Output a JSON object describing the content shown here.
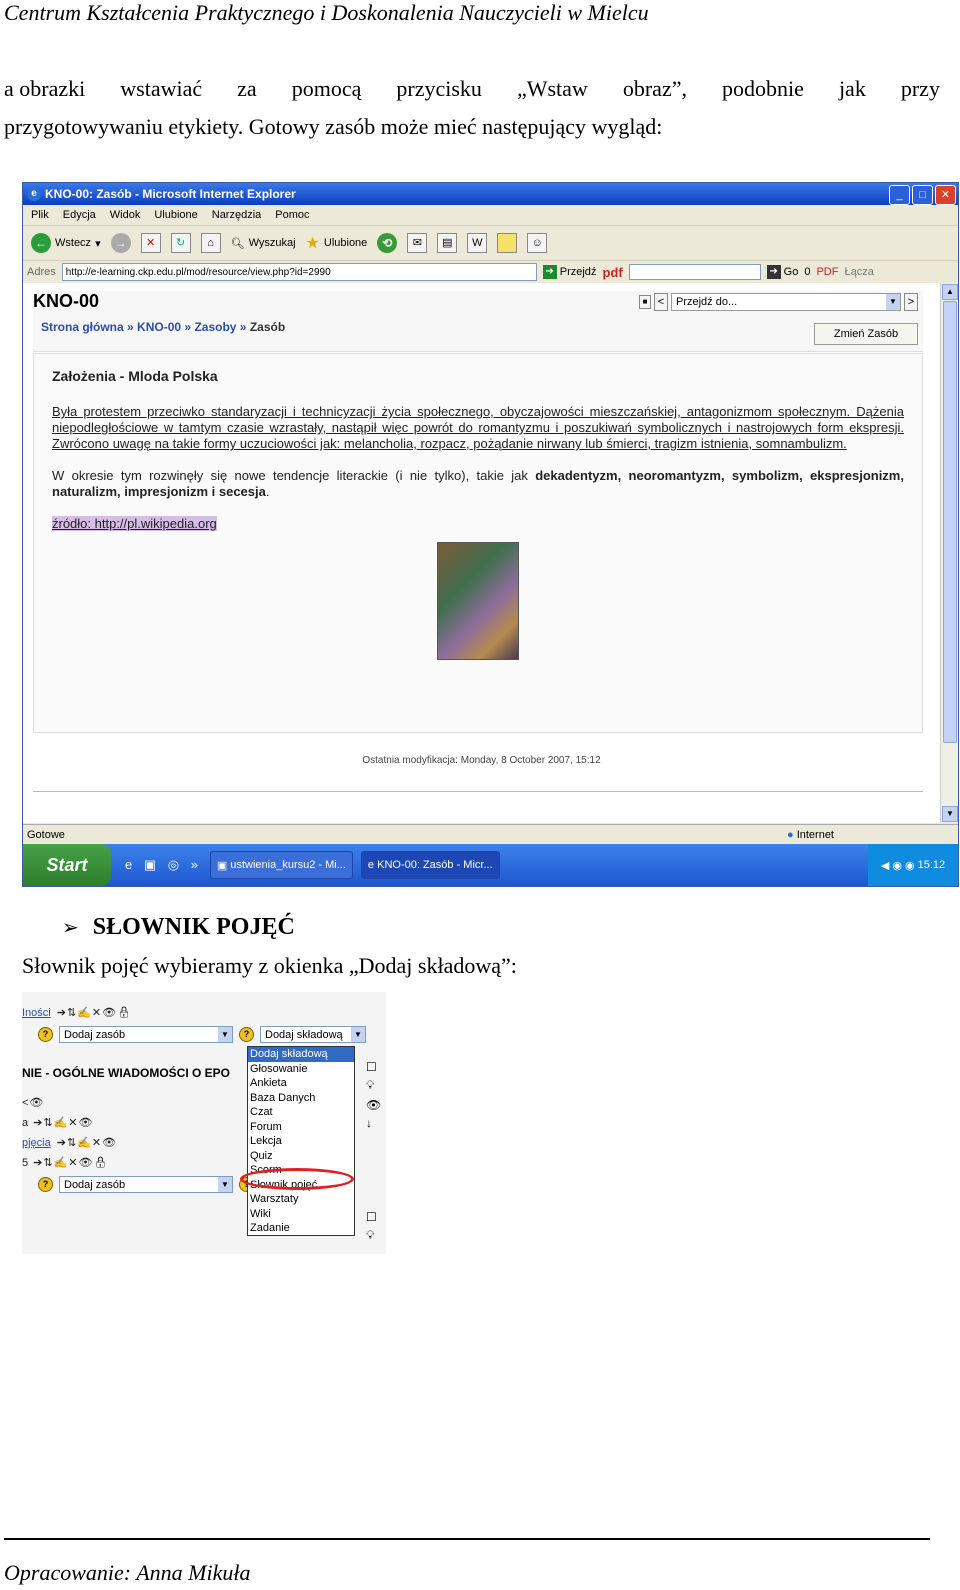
{
  "header": {
    "text": "Centrum Kształcenia Praktycznego i Doskonalenia Nauczycieli w Mielcu"
  },
  "paragraph1": {
    "line1_words": [
      "a obrazki",
      "wstawiać",
      "za",
      "pomocą",
      "przycisku",
      "„Wstaw",
      "obraz”,",
      "podobnie",
      "jak",
      "przy"
    ],
    "line2": "przygotowywaniu etykiety. Gotowy zasób może mieć następujący wygląd:"
  },
  "ie_window": {
    "title": "KNO-00: Zasób - Microsoft Internet Explorer",
    "menu": [
      "Plik",
      "Edycja",
      "Widok",
      "Ulubione",
      "Narzędzia",
      "Pomoc"
    ],
    "toolbar": {
      "back": "Wstecz",
      "search": "Wyszukaj",
      "favorites": "Ulubione"
    },
    "address_label": "Adres",
    "address_url": "http://e-learning.ckp.edu.pl/mod/resource/view.php?id=2990",
    "go_label": "Przejdź",
    "pdf_label": "pdf",
    "go2_label": "Go",
    "counter": "0",
    "pdf2_label": "PDF",
    "links_label": "Łącza",
    "status_left": "Gotowe",
    "status_right": "Internet",
    "taskbar": {
      "start": "Start",
      "task1": "ustwienia_kursu2 - Mi...",
      "task2": "KNO-00: Zasób - Micr...",
      "clock": "15:12"
    },
    "page": {
      "course": "KNO-00",
      "breadcrumb": [
        "Strona główna",
        "KNO-00",
        "Zasoby",
        "Zasób"
      ],
      "breadcrumb_sep": "»",
      "jump_select": "Przejdź do...",
      "edit_button": "Zmień Zasób",
      "heading": "Założenia - Mloda Polska",
      "para1": "Była protestem przeciwko standaryzacji i technicyzacji życia społecznego, obyczajowości mieszczańskiej, antagonizmom społecznym. Dążenia niepodległościowe w tamtym czasie wzrastały, nastąpił więc powrót do romantyzmu i poszukiwań symbolicznych i nastrojowych form ekspresji. Zwrócono uwagę na takie formy uczuciowości jak: melancholia, rozpacz, pożądanie nirwany lub śmierci, tragizm istnienia, somnambulizm.",
      "para2_plain": "W okresie tym rozwinęły się nowe tendencje literackie (i nie tylko), takie jak ",
      "para2_bold": "dekadentyzm, neoromantyzm, symbolizm, ekspresjonizm, naturalizm, impresjonizm i secesja",
      "para2_end": ".",
      "source": "źródło: http://pl.wikipedia.org",
      "modified": "Ostatnia modyfikacja: Monday, 8 October 2007, 15:12"
    }
  },
  "section2": {
    "heading": "SŁOWNIK POJĘĆ",
    "text": "Słownik pojęć wybieramy z okienka „Dodaj składową”:"
  },
  "moodle_snippet": {
    "link_top": "Iności",
    "resource_select": "Dodaj zasób",
    "activity_select": "Dodaj składową",
    "section_heading": "NIE - OGÓLNE WIADOMOŚCI O EPO",
    "row_link": "pjęcia",
    "resource_select2": "Dodaj zasób",
    "options": [
      "Dodaj składową",
      "Głosowanie",
      "Ankieta",
      "Baza Danych",
      "Czat",
      "Forum",
      "Lekcja",
      "Quiz",
      "Scorm",
      "Słownik pojęć",
      "Warsztaty",
      "Wiki",
      "Zadanie"
    ]
  },
  "footer": {
    "text": "Opracowanie: Anna Mikuła"
  }
}
